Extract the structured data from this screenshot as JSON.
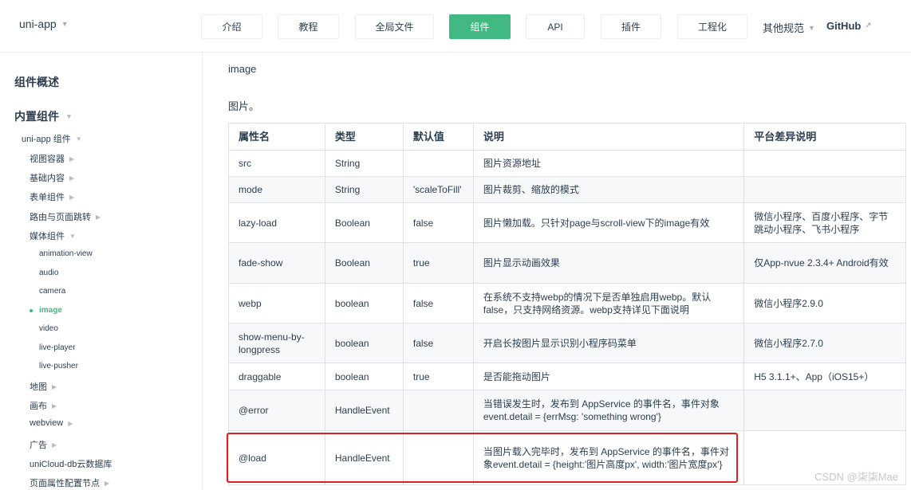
{
  "navbar": {
    "brand": "uni-app",
    "items": [
      {
        "label": "介绍",
        "active": false
      },
      {
        "label": "教程",
        "active": false
      },
      {
        "label": "全局文件",
        "active": false
      },
      {
        "label": "组件",
        "active": true
      },
      {
        "label": "API",
        "active": false
      },
      {
        "label": "插件",
        "active": false
      },
      {
        "label": "工程化",
        "active": false
      }
    ],
    "other_spec": "其他规范",
    "github": "GitHub"
  },
  "sidebar": {
    "overview": "组件概述",
    "builtin": "内置组件",
    "uniapp_components": "uni-app 组件",
    "groups": [
      "视图容器",
      "基础内容",
      "表单组件",
      "路由与页面跳转",
      "媒体组件"
    ],
    "media_items": [
      "animation-view",
      "audio",
      "camera",
      "image",
      "video",
      "live-player",
      "live-pusher"
    ],
    "groups_after": [
      "地图",
      "画布",
      "webview",
      "广告",
      "uniCloud-db云数据库",
      "页面属性配置节点"
    ]
  },
  "page": {
    "title": "image",
    "desc": "图片。"
  },
  "table": {
    "headers": [
      "属性名",
      "类型",
      "默认值",
      "说明",
      "平台差异说明"
    ],
    "rows": [
      [
        "src",
        "String",
        "",
        "图片资源地址",
        ""
      ],
      [
        "mode",
        "String",
        "'scaleToFill'",
        "图片裁剪、缩放的模式",
        ""
      ],
      [
        "lazy-load",
        "Boolean",
        "false",
        "图片懒加载。只针对page与scroll-view下的image有效",
        "微信小程序、百度小程序、字节跳动小程序、飞书小程序"
      ],
      [
        "fade-show",
        "Boolean",
        "true",
        "图片显示动画效果",
        "仅App-nvue 2.3.4+ Android有效"
      ],
      [
        "webp",
        "boolean",
        "false",
        "在系统不支持webp的情况下是否单独启用webp。默认false，只支持网络资源。webp支持详见下面说明",
        "微信小程序2.9.0"
      ],
      [
        "show-menu-by-longpress",
        "boolean",
        "false",
        "开启长按图片显示识别小程序码菜单",
        "微信小程序2.7.0"
      ],
      [
        "draggable",
        "boolean",
        "true",
        "是否能拖动图片",
        "H5 3.1.1+、App（iOS15+）"
      ],
      [
        "@error",
        "HandleEvent",
        "",
        "当错误发生时，发布到 AppService 的事件名，事件对象event.detail = {errMsg: 'something wrong'}",
        ""
      ],
      [
        "@load",
        "HandleEvent",
        "",
        "当图片载入完毕时，发布到 AppService 的事件名，事件对象event.detail = {height:'图片高度px', width:'图片宽度px'}",
        ""
      ]
    ]
  },
  "watermark": "CSDN @柒柒Mae",
  "colors": {
    "accent": "#42b983",
    "highlight": "#e02020"
  }
}
